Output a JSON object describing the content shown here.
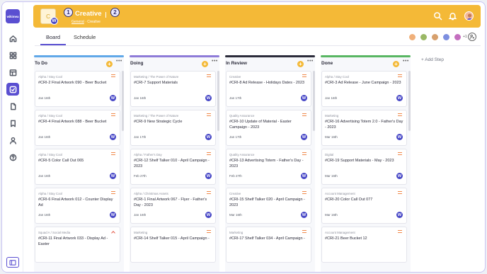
{
  "brand": {
    "logo_text": "wikimea"
  },
  "header": {
    "title": "Creative",
    "breadcrumb": {
      "link": "General",
      "separator": "·",
      "current": "Creative"
    },
    "marker_1": "1",
    "marker_2": "2",
    "workspace_avatar": "W",
    "thumbnail_letter": "C"
  },
  "tabs": [
    {
      "label": "Board",
      "active": true
    },
    {
      "label": "Schedule",
      "active": false
    }
  ],
  "team": {
    "extra_count": "+1"
  },
  "add_step_label": "+ Add Step",
  "colors": {
    "accent": "#5a4fd1",
    "banner": "#f4b937",
    "todo": "#60a8e8",
    "doing": "#8e7bd8",
    "review": "#2b2b3a",
    "done": "#58b662"
  },
  "icons": [
    "home-icon",
    "grid-icon",
    "calendar-icon",
    "board-icon",
    "document-icon",
    "bookmark-icon",
    "user-icon",
    "help-icon",
    "search-icon",
    "bell-icon",
    "sidebar-toggle-icon"
  ],
  "columns": [
    {
      "title": "To Do",
      "cards": [
        {
          "category": "Alpha / Stay Cool",
          "title": "#CRI-2 Final Artwork 090 - Beer Bucket",
          "date": "Jan 16th",
          "avatar": "W"
        },
        {
          "category": "Alpha / Stay Cool",
          "title": "#CRI-4 Final Artwork 088 - Beer Bucket",
          "date": "Jan 16th",
          "avatar": "W"
        },
        {
          "category": "Alpha / Stay Cool",
          "title": "#CRI-5 Color Call Out 065",
          "date": "Jan 16th",
          "avatar": "W"
        },
        {
          "category": "Alpha / Stay Cool",
          "title": "#CRI-6 Final Artwork 012 - Counter Display Ad",
          "date": "Jan 16th",
          "avatar": "W"
        },
        {
          "category": "Squad A / Social Media",
          "title": "#CRI-11 Final Artwork 033 - Display Ad - Easter",
          "date": "",
          "avatar": ""
        }
      ]
    },
    {
      "title": "Doing",
      "cards": [
        {
          "category": "Marketing / The Power of Nature",
          "title": "#CRI-7 Support Materials",
          "date": "Jan 16th",
          "avatar": "W"
        },
        {
          "category": "Marketing / The Power of Nature",
          "title": "#CRI-9 New Strategic Cycle",
          "date": "Jan 17th",
          "avatar": "W"
        },
        {
          "category": "Alpha / Father's Day",
          "title": "#CRI-12 Shelf Talker 010 - April Campaign - 2023",
          "date": "Feb 27th",
          "avatar": "W"
        },
        {
          "category": "Alpha / Christmas Assets",
          "title": "#CRI-1 Final Artwork 067 - Flyer - Father's Day - 2023",
          "date": "Jan 16th",
          "avatar": "W"
        },
        {
          "category": "Marketing",
          "title": "#CRI-14 Shelf Talker 015 - April Campaign -",
          "date": "",
          "avatar": ""
        }
      ]
    },
    {
      "title": "In Review",
      "cards": [
        {
          "category": "Creative",
          "title": "#CRI-8 Ad Release - Holidays Dates - 2023",
          "date": "Jan 17th",
          "avatar": "W"
        },
        {
          "category": "Quality Assurance",
          "title": "#CRI-10 Update of Material - Easter Campaign - 2023",
          "date": "Jan 17th",
          "avatar": "W"
        },
        {
          "category": "Quality Assurance",
          "title": "#CRI-13 Advertising Totem - Father's Day - 2023",
          "date": "Feb 27th",
          "avatar": "W"
        },
        {
          "category": "Creative",
          "title": "#CRI-15 Shelf Talker 020 - April Campaign - 2023",
          "date": "Mar 16th",
          "avatar": "W"
        },
        {
          "category": "Marketing",
          "title": "#CRI-17 Shelf Talker 034 - April Campaign -",
          "date": "",
          "avatar": ""
        }
      ]
    },
    {
      "title": "Done",
      "cards": [
        {
          "category": "Alpha / Stay Cool",
          "title": "#CRI-3 Ad Release - June Campaign - 2023",
          "date": "Jan 16th",
          "avatar": "W"
        },
        {
          "category": "Marketing",
          "title": "#CRI-16 Advertising Totem 2.0 - Father's Day - 2023",
          "date": "Mar 16th",
          "avatar": "W"
        },
        {
          "category": "Digital",
          "title": "#CRI-19 Support Materials - May - 2023",
          "date": "Mar 16th",
          "avatar": "W"
        },
        {
          "category": "Account Management",
          "title": "#CRI-20 Color Call Out 077",
          "date": "Mar 16th",
          "avatar": "W"
        },
        {
          "category": "Account Management",
          "title": "#CRI-21 Beer Bucket 12",
          "date": "",
          "avatar": ""
        }
      ]
    }
  ]
}
